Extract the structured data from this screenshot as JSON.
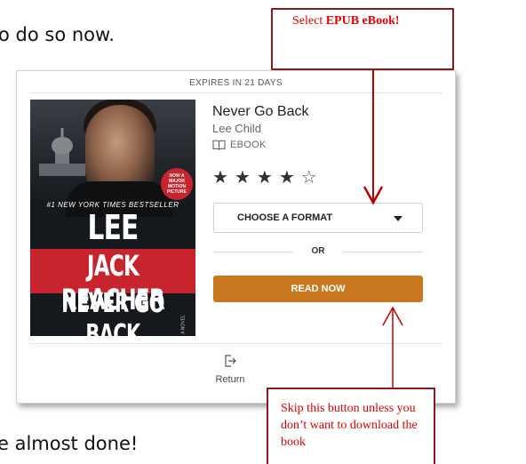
{
  "document": {
    "top_text": "o do so now.",
    "bottom_text": "e almost done!"
  },
  "card": {
    "expires": "EXPIRES IN 21 DAYS",
    "book": {
      "title": "Never Go Back",
      "author": "Lee Child",
      "format": "EBOOK",
      "rating_stars": 4,
      "rating_max": 5
    },
    "cover": {
      "bestseller": "#1 NEW YORK TIMES BESTSELLER",
      "author": "LEE CHILD",
      "series": "JACK REACHER",
      "title": "NEVER GO BACK",
      "badge": "NOW A MAJOR MOTION PICTURE",
      "subtitle": "A NOVEL"
    },
    "choose_format_label": "CHOOSE A FORMAT",
    "or_label": "OR",
    "read_now_label": "READ NOW",
    "return_label": "Return"
  },
  "callouts": {
    "top_line1": "Select ",
    "top_bold": "EPUB eBook!",
    "bottom": "Skip this button unless you don’t want to download the book"
  },
  "colors": {
    "accent_button": "#c8781f",
    "callout_text": "#e00000",
    "callout_border": "#8b1a1a",
    "arrow": "#c00000"
  }
}
